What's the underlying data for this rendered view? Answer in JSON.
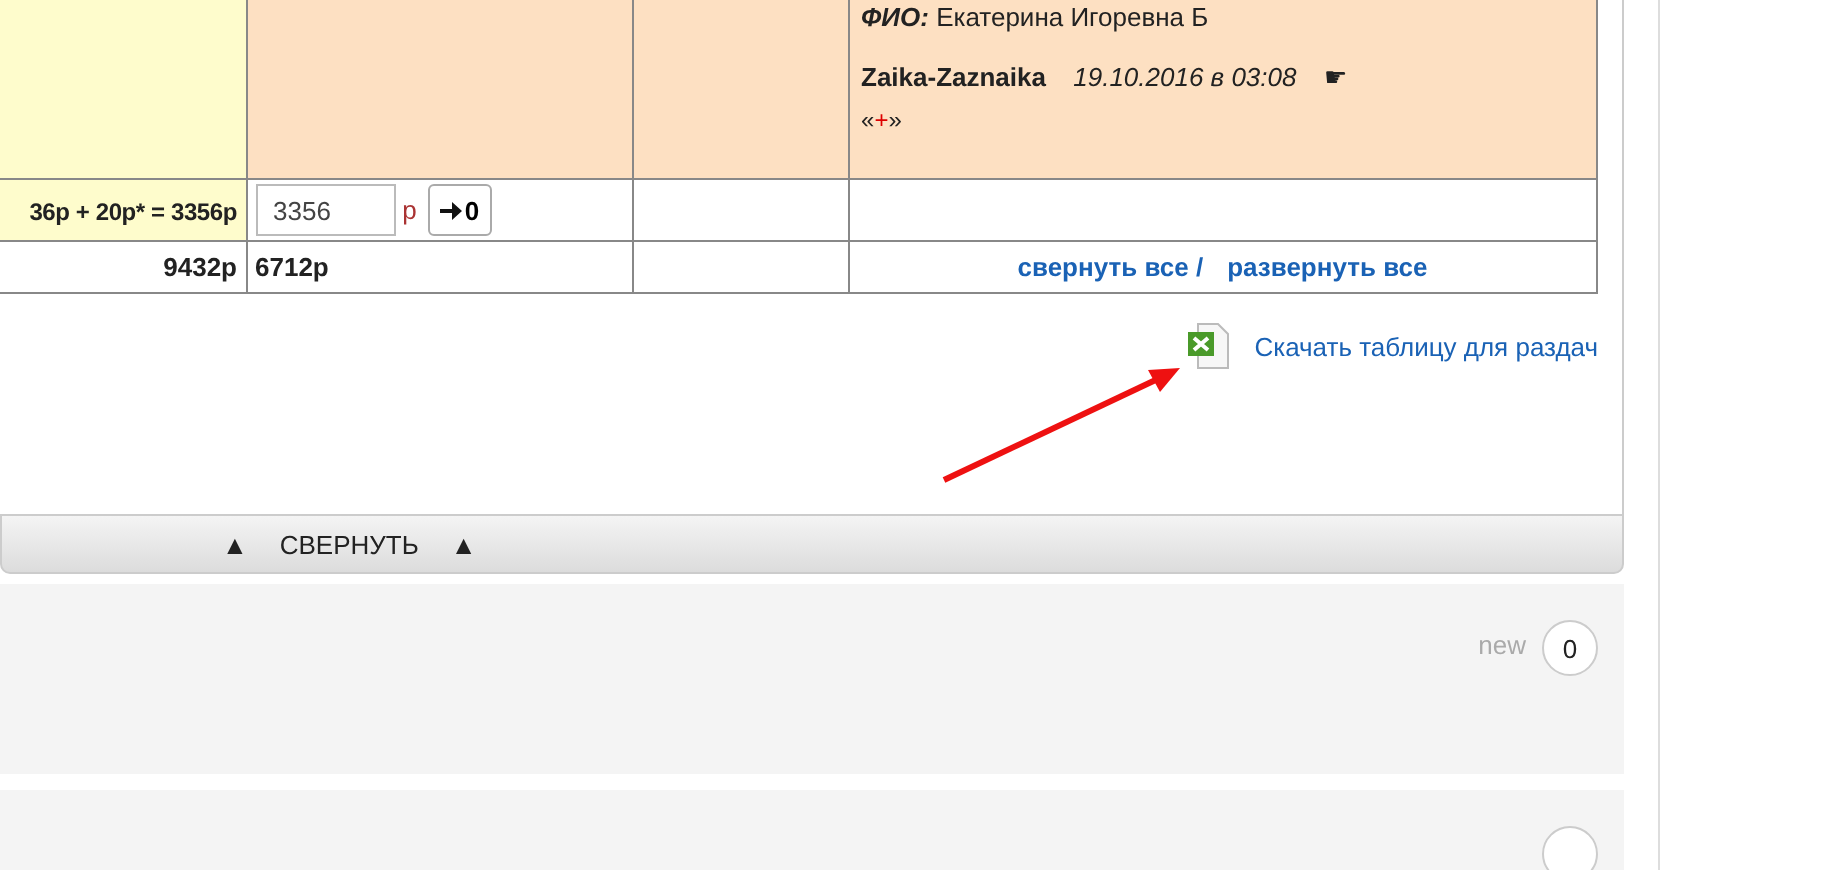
{
  "comment": {
    "fio_label": "ФИО:",
    "fio": "Екатерина Игоревна Б",
    "author": "Zaika-Zaznaika",
    "date": "19.10.2016 в 03:08",
    "pointer": "☛",
    "vote_open": "«",
    "vote_mark": "+",
    "vote_close": "»"
  },
  "sum_row": {
    "formula": "36р + 20р* = 3356р",
    "amount": "3356",
    "currency": "р",
    "apply_label": "0"
  },
  "totals": [
    "9432р",
    "6712р"
  ],
  "collapse_all": "свернуть все",
  "separator": "/",
  "expand_all": "развернуть все",
  "download_link": "Скачать таблицу для раздач",
  "collapse_bar": [
    "▲",
    "СВЕРНУТЬ",
    "▲"
  ],
  "cards": [
    {
      "new_label": "new",
      "count": "0"
    }
  ]
}
